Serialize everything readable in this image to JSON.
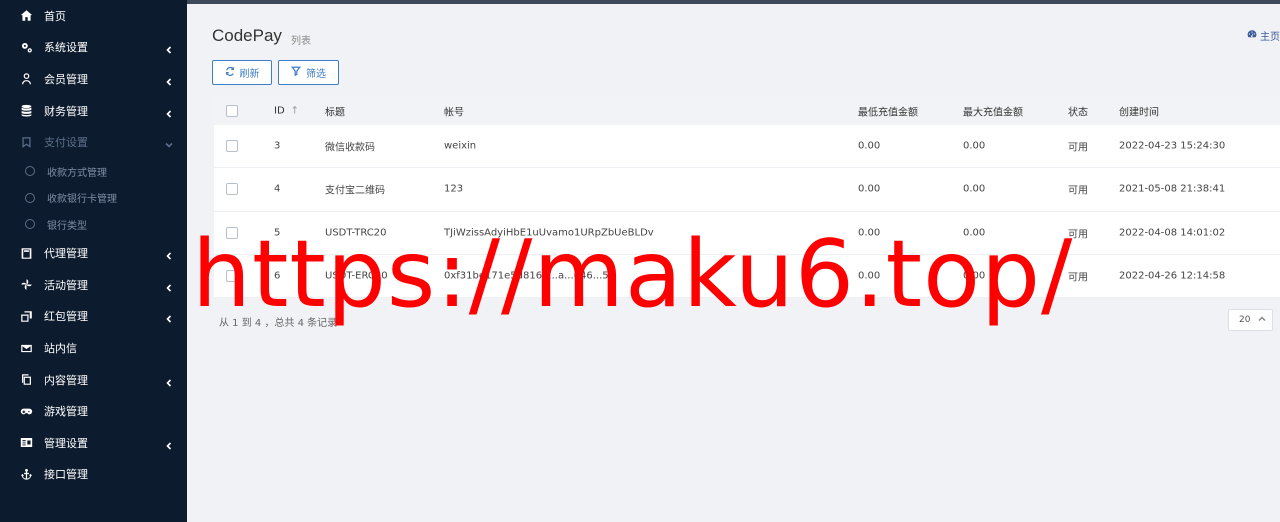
{
  "sidebar": {
    "items": [
      {
        "label": "首页",
        "icon": "home-icon",
        "has_children": false,
        "open": false
      },
      {
        "label": "系统设置",
        "icon": "cogs-icon",
        "has_children": true,
        "open": false
      },
      {
        "label": "会员管理",
        "icon": "user-icon",
        "has_children": true,
        "open": false
      },
      {
        "label": "财务管理",
        "icon": "database-icon",
        "has_children": true,
        "open": false
      },
      {
        "label": "支付设置",
        "icon": "bookmark-icon",
        "has_children": true,
        "open": true
      },
      {
        "label": "代理管理",
        "icon": "book-icon",
        "has_children": true,
        "open": false
      },
      {
        "label": "活动管理",
        "icon": "pinwheel-icon",
        "has_children": true,
        "open": false
      },
      {
        "label": "红包管理",
        "icon": "clone-icon",
        "has_children": true,
        "open": false
      },
      {
        "label": "站内信",
        "icon": "envelope-icon",
        "has_children": false,
        "open": false
      },
      {
        "label": "内容管理",
        "icon": "copy-icon",
        "has_children": true,
        "open": false
      },
      {
        "label": "游戏管理",
        "icon": "gamepad-icon",
        "has_children": false,
        "open": false
      },
      {
        "label": "管理设置",
        "icon": "id-card-icon",
        "has_children": true,
        "open": false
      },
      {
        "label": "接口管理",
        "icon": "anchor-icon",
        "has_children": false,
        "open": false
      }
    ],
    "sub_items": [
      "收款方式管理",
      "收款银行卡管理",
      "银行类型"
    ]
  },
  "header": {
    "title": "CodePay",
    "subtitle": "列表",
    "breadcrumb": "主页"
  },
  "toolbar": {
    "refresh_label": "刷新",
    "filter_label": "筛选"
  },
  "table": {
    "columns": [
      "ID",
      "标题",
      "帐号",
      "最低充值金额",
      "最大充值金额",
      "状态",
      "创建时间"
    ],
    "rows": [
      {
        "id": "3",
        "title": "微信收款码",
        "account": "weixin",
        "min": "0.00",
        "max": "0.00",
        "status": "可用",
        "created": "2022-04-23 15:24:30"
      },
      {
        "id": "4",
        "title": "支付宝二维码",
        "account": "123",
        "min": "0.00",
        "max": "0.00",
        "status": "可用",
        "created": "2021-05-08 21:38:41"
      },
      {
        "id": "5",
        "title": "USDT-TRC20",
        "account": "TJiWzissAdyiHbE1uUvamo1URpZbUeBLDv",
        "min": "0.00",
        "max": "0.00",
        "status": "可用",
        "created": "2022-04-08 14:01:02"
      },
      {
        "id": "6",
        "title": "USDT-ERC20",
        "account": "0xf31be171e5d8161...a...646...59",
        "min": "0.00",
        "max": "0.00",
        "status": "可用",
        "created": "2022-04-26 12:14:58"
      }
    ]
  },
  "footer": {
    "info": "从 1 到 4 ，总共 4 条记录",
    "page_size": "20"
  },
  "watermark": "https://maku6.top/",
  "colors": {
    "sidebar_bg": "#0d1b2e",
    "accent": "#3f7ec4",
    "watermark": "#ff0000"
  }
}
